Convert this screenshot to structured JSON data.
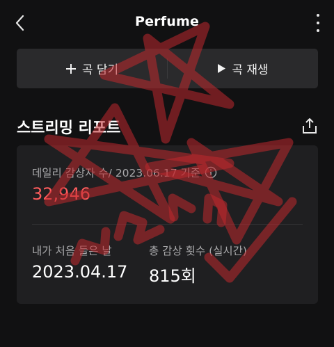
{
  "header": {
    "title": "Perfume",
    "back_icon": "chevron-left-icon",
    "more_icon": "more-vertical-icon"
  },
  "actions": {
    "add_label": "곡 담기",
    "add_icon": "plus-icon",
    "play_label": "곡 재생",
    "play_icon": "play-icon"
  },
  "report": {
    "title": "스트리밍 리포트",
    "share_icon": "share-icon",
    "daily_label": "데일리 감상자 수/ 2023.06.17 기준",
    "info_icon": "info-icon",
    "daily_value": "32,946",
    "first_listen_label": "내가 처음 들은 날",
    "first_listen_value": "2023.04.17",
    "total_label": "총 감상 횟수 (실시간)",
    "total_value": "815회"
  },
  "colors": {
    "background": "#111112",
    "card": "#1f1f21",
    "accent_red": "#ff5d5d",
    "doodle": "#c0282d"
  }
}
